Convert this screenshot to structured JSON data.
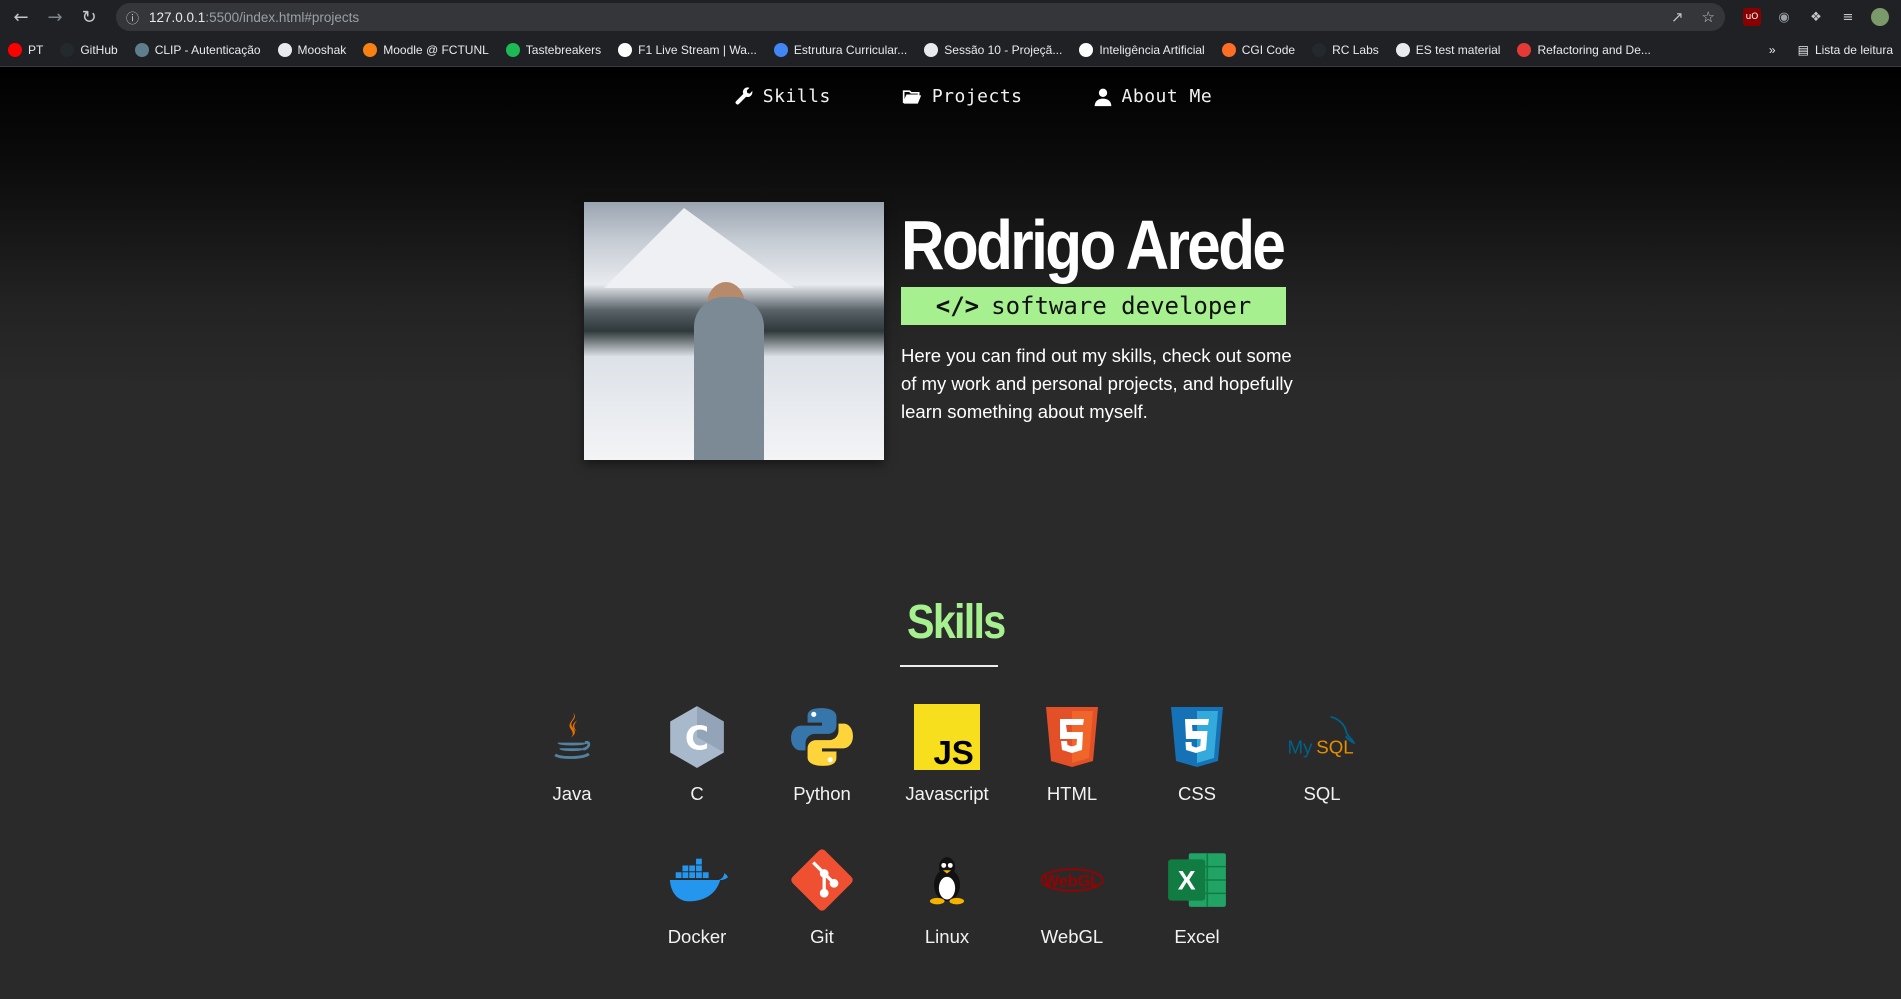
{
  "browser": {
    "url_host": "127.0.0.1",
    "url_path": ":5500/index.html#projects",
    "bookmarks": [
      {
        "label": "PT",
        "color": "#ff0000"
      },
      {
        "label": "GitHub",
        "color": "#24292e"
      },
      {
        "label": "CLIP - Autenticação",
        "color": "#607d8b"
      },
      {
        "label": "Mooshak",
        "color": "#e8eaed"
      },
      {
        "label": "Moodle @ FCTUNL",
        "color": "#f98012"
      },
      {
        "label": "Tastebreakers",
        "color": "#1db954"
      },
      {
        "label": "F1 Live Stream | Wa...",
        "color": "#ffffff"
      },
      {
        "label": "Estrutura Curricular...",
        "color": "#4285f4"
      },
      {
        "label": "Sessão 10 - Projeçã...",
        "color": "#e8eaed"
      },
      {
        "label": "Inteligência Artificial",
        "color": "#ffffff"
      },
      {
        "label": "CGI Code",
        "color": "#fc6d26"
      },
      {
        "label": "RC Labs",
        "color": "#24292e"
      },
      {
        "label": "ES test material",
        "color": "#e8eaed"
      },
      {
        "label": "Refactoring and De...",
        "color": "#e53935"
      }
    ],
    "more_label": "»",
    "reading_list_label": "Lista de leitura"
  },
  "nav": {
    "skills": "Skills",
    "projects": "Projects",
    "about": "About Me"
  },
  "hero": {
    "name": "Rodrigo Arede",
    "badge_icon": "</>",
    "role": "software developer",
    "intro": "Here you can find out my skills, check out some of my work and personal projects, and hopefully learn something about myself."
  },
  "skills": {
    "title": "Skills",
    "row1": [
      {
        "label": "Java",
        "icon": "java-icon"
      },
      {
        "label": "C",
        "icon": "c-icon"
      },
      {
        "label": "Python",
        "icon": "python-icon"
      },
      {
        "label": "Javascript",
        "icon": "javascript-icon"
      },
      {
        "label": "HTML",
        "icon": "html-icon"
      },
      {
        "label": "CSS",
        "icon": "css-icon"
      },
      {
        "label": "SQL",
        "icon": "mysql-icon"
      }
    ],
    "row2": [
      {
        "label": "Docker",
        "icon": "docker-icon"
      },
      {
        "label": "Git",
        "icon": "git-icon"
      },
      {
        "label": "Linux",
        "icon": "linux-icon"
      },
      {
        "label": "WebGL",
        "icon": "webgl-icon"
      },
      {
        "label": "Excel",
        "icon": "excel-icon"
      }
    ]
  },
  "colors": {
    "accent": "#a7f08f",
    "background": "#2a2a2a"
  }
}
